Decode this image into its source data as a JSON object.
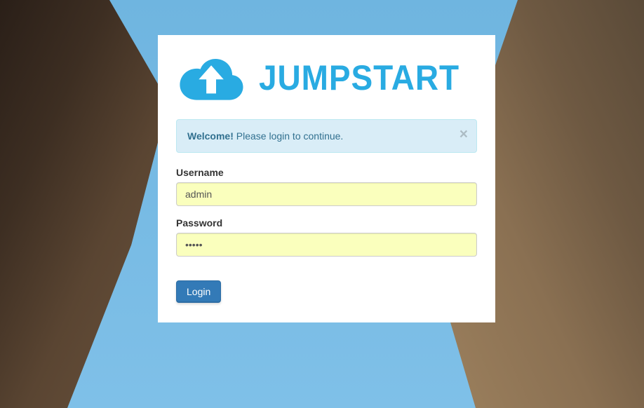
{
  "logo": {
    "brand_text": "JUMPSTART"
  },
  "alert": {
    "strong": "Welcome!",
    "message": " Please login to continue.",
    "close_glyph": "×"
  },
  "form": {
    "username": {
      "label": "Username",
      "value": "admin"
    },
    "password": {
      "label": "Password",
      "value": "•••••"
    },
    "submit_label": "Login"
  }
}
